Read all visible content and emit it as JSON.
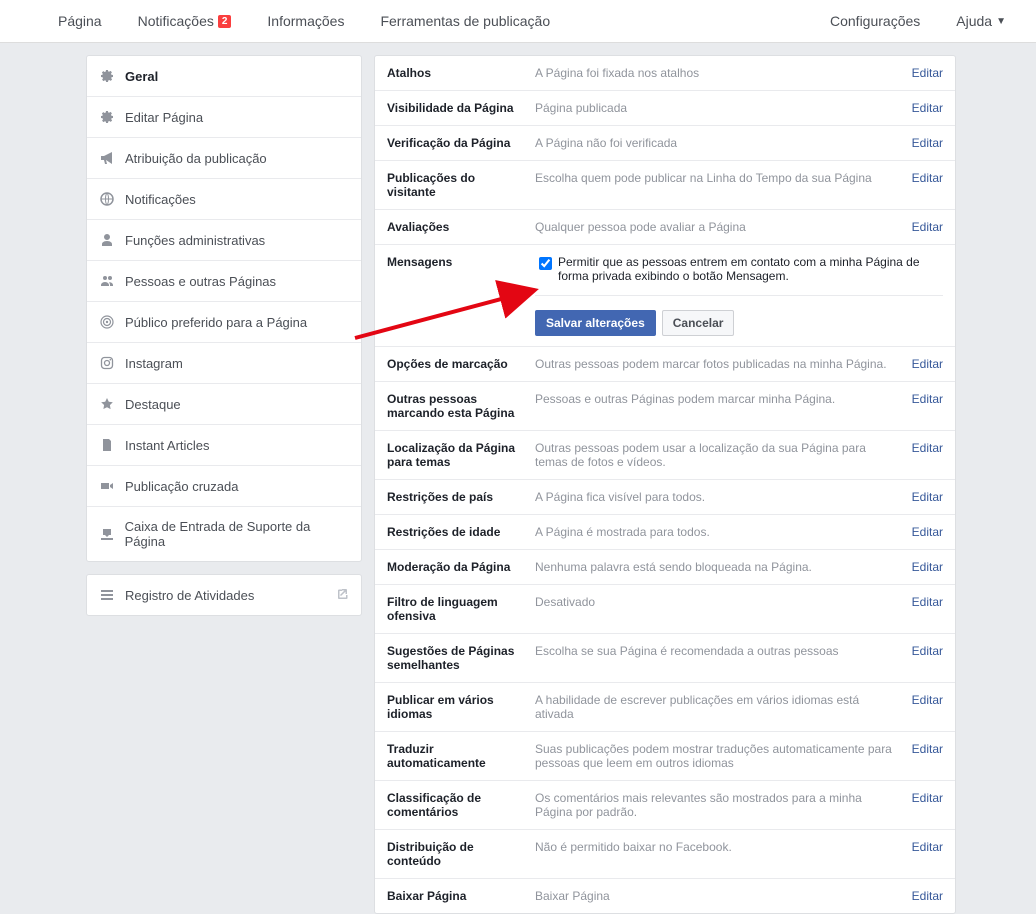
{
  "topnav": {
    "left": [
      {
        "label": "Página"
      },
      {
        "label": "Notificações",
        "badge": "2"
      },
      {
        "label": "Informações"
      },
      {
        "label": "Ferramentas de publicação"
      }
    ],
    "right": [
      {
        "label": "Configurações"
      },
      {
        "label": "Ajuda",
        "dropdown": true
      }
    ]
  },
  "sidebar": {
    "items": [
      {
        "icon": "gear",
        "label": "Geral",
        "active": true
      },
      {
        "icon": "gear",
        "label": "Editar Página"
      },
      {
        "icon": "megaphone",
        "label": "Atribuição da publicação"
      },
      {
        "icon": "globe",
        "label": "Notificações"
      },
      {
        "icon": "person",
        "label": "Funções administrativas"
      },
      {
        "icon": "people",
        "label": "Pessoas e outras Páginas"
      },
      {
        "icon": "target",
        "label": "Público preferido para a Página"
      },
      {
        "icon": "instagram",
        "label": "Instagram"
      },
      {
        "icon": "star",
        "label": "Destaque"
      },
      {
        "icon": "page",
        "label": "Instant Articles"
      },
      {
        "icon": "video",
        "label": "Publicação cruzada"
      },
      {
        "icon": "inbox",
        "label": "Caixa de Entrada de Suporte da Página"
      }
    ],
    "activity": {
      "icon": "list",
      "label": "Registro de Atividades"
    }
  },
  "editLabel": "Editar",
  "settings": [
    {
      "label": "Atalhos",
      "desc": "A Página foi fixada nos atalhos"
    },
    {
      "label": "Visibilidade da Página",
      "desc": "Página publicada"
    },
    {
      "label": "Verificação da Página",
      "desc": "A Página não foi verificada"
    },
    {
      "label": "Publicações do visitante",
      "desc": "Escolha quem pode publicar na Linha do Tempo da sua Página"
    },
    {
      "label": "Avaliações",
      "desc": "Qualquer pessoa pode avaliar a Página"
    }
  ],
  "messages": {
    "label": "Mensagens",
    "checkboxText": "Permitir que as pessoas entrem em contato com a minha Página de forma privada exibindo o botão Mensagem.",
    "save": "Salvar alterações",
    "cancel": "Cancelar"
  },
  "settings2": [
    {
      "label": "Opções de marcação",
      "desc": "Outras pessoas podem marcar fotos publicadas na minha Página."
    },
    {
      "label": "Outras pessoas marcando esta Página",
      "desc": "Pessoas e outras Páginas podem marcar minha Página."
    },
    {
      "label": "Localização da Página para temas",
      "desc": "Outras pessoas podem usar a localização da sua Página para temas de fotos e vídeos."
    },
    {
      "label": "Restrições de país",
      "desc": "A Página fica visível para todos."
    },
    {
      "label": "Restrições de idade",
      "desc": "A Página é mostrada para todos."
    },
    {
      "label": "Moderação da Página",
      "desc": "Nenhuma palavra está sendo bloqueada na Página."
    },
    {
      "label": "Filtro de linguagem ofensiva",
      "desc": "Desativado"
    },
    {
      "label": "Sugestões de Páginas semelhantes",
      "desc": "Escolha se sua Página é recomendada a outras pessoas"
    },
    {
      "label": "Publicar em vários idiomas",
      "desc": "A habilidade de escrever publicações em vários idiomas está ativada"
    },
    {
      "label": "Traduzir automaticamente",
      "desc": "Suas publicações podem mostrar traduções automaticamente para pessoas que leem em outros idiomas"
    },
    {
      "label": "Classificação de comentários",
      "desc": "Os comentários mais relevantes são mostrados para a minha Página por padrão."
    },
    {
      "label": "Distribuição de conteúdo",
      "desc": "Não é permitido baixar no Facebook."
    },
    {
      "label": "Baixar Página",
      "desc": "Baixar Página"
    }
  ]
}
